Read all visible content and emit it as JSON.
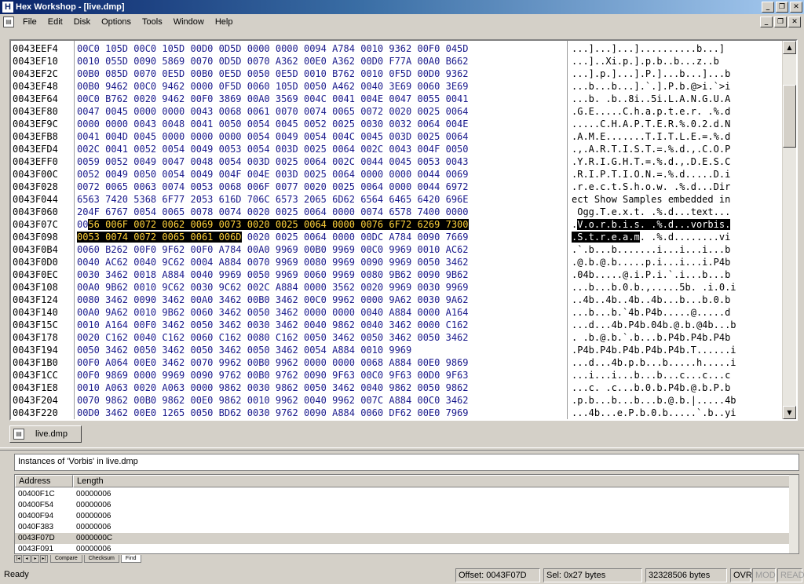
{
  "window": {
    "title": "Hex Workshop - [live.dmp]",
    "app_icon": "H"
  },
  "menu": [
    "File",
    "Edit",
    "Disk",
    "Options",
    "Tools",
    "Window",
    "Help"
  ],
  "hex": {
    "rows": [
      {
        "off": "0043EEF4",
        "hex": "00C0 105D 00C0 105D 00D0 0D5D 0000 0000 0094 A784 0010 9362 00F0 045D",
        "asc": "...]...]...]..........b...]"
      },
      {
        "off": "0043EF10",
        "hex": "0010 055D 0090 5869 0070 0D5D 0070 A362 00E0 A362 00D0 F77A 00A0 B662",
        "asc": "...]..Xi.p.].p.b..b...z..b"
      },
      {
        "off": "0043EF2C",
        "hex": "00B0 085D 0070 0E5D 00B0 0E5D 0050 0E5D 0010 B762 0010 0F5D 00D0 9362",
        "asc": "...].p.]...].P.]...b...]...b"
      },
      {
        "off": "0043EF48",
        "hex": "00B0 9462 00C0 9462 0000 0F5D 0060 105D 0050 A462 0040 3E69 0060 3E69",
        "asc": "...b...b...].`.].P.b.@>i.`>i"
      },
      {
        "off": "0043EF64",
        "hex": "00C0 B762 0020 9462 00F0 3869 00A0 3569 004C 0041 004E 0047 0055 0041",
        "asc": "...b. .b..8i..5i.L.A.N.G.U.A"
      },
      {
        "off": "0043EF80",
        "hex": "0047 0045 0000 0000 0043 0068 0061 0070 0074 0065 0072 0020 0025 0064",
        "asc": ".G.E.....C.h.a.p.t.e.r. .%.d"
      },
      {
        "off": "0043EF9C",
        "hex": "0000 0000 0043 0048 0041 0050 0054 0045 0052 0025 0030 0032 0064 004E",
        "asc": ".....C.H.A.P.T.E.R.%.0.2.d.N"
      },
      {
        "off": "0043EFB8",
        "hex": "0041 004D 0045 0000 0000 0000 0054 0049 0054 004C 0045 003D 0025 0064",
        "asc": ".A.M.E.......T.I.T.L.E.=.%.d"
      },
      {
        "off": "0043EFD4",
        "hex": "002C 0041 0052 0054 0049 0053 0054 003D 0025 0064 002C 0043 004F 0050",
        "asc": ".,.A.R.T.I.S.T.=.%.d.,.C.O.P"
      },
      {
        "off": "0043EFF0",
        "hex": "0059 0052 0049 0047 0048 0054 003D 0025 0064 002C 0044 0045 0053 0043",
        "asc": ".Y.R.I.G.H.T.=.%.d.,.D.E.S.C"
      },
      {
        "off": "0043F00C",
        "hex": "0052 0049 0050 0054 0049 004F 004E 003D 0025 0064 0000 0000 0044 0069",
        "asc": ".R.I.P.T.I.O.N.=.%.d.....D.i"
      },
      {
        "off": "0043F028",
        "hex": "0072 0065 0063 0074 0053 0068 006F 0077 0020 0025 0064 0000 0044 6972",
        "asc": ".r.e.c.t.S.h.o.w. .%.d...Dir"
      },
      {
        "off": "0043F044",
        "hex": "6563 7420 5368 6F77 2053 616D 706C 6573 2065 6D62 6564 6465 6420 696E",
        "asc": "ect Show Samples embedded in"
      },
      {
        "off": "0043F060",
        "hex": "204F 6767 0054 0065 0078 0074 0020 0025 0064 0000 0074 6578 7400 0000",
        "asc": " Ogg.T.e.x.t. .%.d...text..."
      },
      {
        "off": "0043F07C",
        "hex_pre": "00",
        "hex_sel": "56 006F 0072 0062 0069 0073 0020 0025 0064 0000 0076 6F72 6269 7300",
        "hex_post": "",
        "asc_pre": ".",
        "asc_sel": "V.o.r.b.i.s. .%.d...vorbis.",
        "asc_post": ""
      },
      {
        "off": "0043F098",
        "hex_pre": "",
        "hex_sel": "0053 0074 0072 0065 0061 006D",
        "hex_post": " 0020 0025 0064 0000 00DC A784 0090 7669",
        "asc_pre": "",
        "asc_sel": ".S.t.r.e.a.m",
        "asc_post": ". .%.d........vi"
      },
      {
        "off": "0043F0B4",
        "hex": "0060 B262 00F0 9F62 00F0 A784 00A0 9969 00B0 9969 00C0 9969 0010 AC62",
        "asc": ".`.b...b.......i...i...i...b"
      },
      {
        "off": "0043F0D0",
        "hex": "0040 AC62 0040 9C62 0004 A884 0070 9969 0080 9969 0090 9969 0050 3462",
        "asc": ".@.b.@.b.....p.i...i...i.P4b"
      },
      {
        "off": "0043F0EC",
        "hex": "0030 3462 0018 A884 0040 9969 0050 9969 0060 9969 0080 9B62 0090 9B62",
        "asc": ".04b.....@.i.P.i.`.i...b...b"
      },
      {
        "off": "0043F108",
        "hex": "00A0 9B62 0010 9C62 0030 9C62 002C A884 0000 3562 0020 9969 0030 9969",
        "asc": "...b...b.0.b.,.....5b. .i.0.i"
      },
      {
        "off": "0043F124",
        "hex": "0080 3462 0090 3462 00A0 3462 00B0 3462 00C0 9962 0000 9A62 0030 9A62",
        "asc": "..4b..4b..4b..4b...b...b.0.b"
      },
      {
        "off": "0043F140",
        "hex": "00A0 9A62 0010 9B62 0060 3462 0050 3462 0000 0000 0040 A884 0000 A164",
        "asc": "...b...b.`4b.P4b.....@.....d"
      },
      {
        "off": "0043F15C",
        "hex": "0010 A164 00F0 3462 0050 3462 0030 3462 0040 9862 0040 3462 0000 C162",
        "asc": "...d...4b.P4b.04b.@.b.@4b...b"
      },
      {
        "off": "0043F178",
        "hex": "0020 C162 0040 C162 0060 C162 0080 C162 0050 3462 0050 3462 0050 3462",
        "asc": ". .b.@.b.`.b...b.P4b.P4b.P4b"
      },
      {
        "off": "0043F194",
        "hex": "0050 3462 0050 3462 0050 3462 0050 3462 0054 A884 0010 9969",
        "asc": ".P4b.P4b.P4b.P4b.P4b.T......i"
      },
      {
        "off": "0043F1B0",
        "hex": "00F0 A064 00E0 3462 0070 9962 00B0 9962 0000 0000 0068 A884 00E0 9869",
        "asc": "...d...4b.p.b...b.....h.....i"
      },
      {
        "off": "0043F1CC",
        "hex": "00F0 9869 0000 9969 0090 9762 00B0 9762 0090 9F63 00C0 9F63 00D0 9F63",
        "asc": "...i...i...b...b...c...c...c"
      },
      {
        "off": "0043F1E8",
        "hex": "0010 A063 0020 A063 0000 9862 0030 9862 0050 3462 0040 9862 0050 9862",
        "asc": "...c. .c...b.0.b.P4b.@.b.P.b"
      },
      {
        "off": "0043F204",
        "hex": "0070 9862 00B0 9862 00E0 9862 0010 9962 0040 9962 007C A884 00C0 3462",
        "asc": ".p.b...b...b...b.@.b.|.....4b"
      },
      {
        "off": "0043F220",
        "hex": "00D0 3462 00E0 1265 0050 BD62 0030 9762 0090 A884 0060 DF62 00E0 7969",
        "asc": "...4b...e.P.b.0.b.....`.b..yi"
      }
    ]
  },
  "doc_tab": {
    "label": "live.dmp"
  },
  "results": {
    "title": "Instances of 'Vorbis' in live.dmp",
    "columns": [
      "Address",
      "Length"
    ],
    "rows": [
      {
        "address": "00400F1C",
        "length": "00000006"
      },
      {
        "address": "00400F54",
        "length": "00000006"
      },
      {
        "address": "00400F94",
        "length": "00000006"
      },
      {
        "address": "0040F383",
        "length": "00000006"
      },
      {
        "address": "0043F07D",
        "length": "0000000C"
      },
      {
        "address": "0043F091",
        "length": "00000006"
      }
    ],
    "selected_index": 4,
    "tabs": [
      "Compare",
      "Checksum",
      "Find"
    ],
    "active_tab": "Find"
  },
  "status": {
    "ready": "Ready",
    "offset": "Offset: 0043F07D",
    "sel": "Sel: 0x27 bytes",
    "size": "32328506 bytes",
    "ovr": "OVR",
    "mod": "MOD",
    "read": "READ"
  }
}
